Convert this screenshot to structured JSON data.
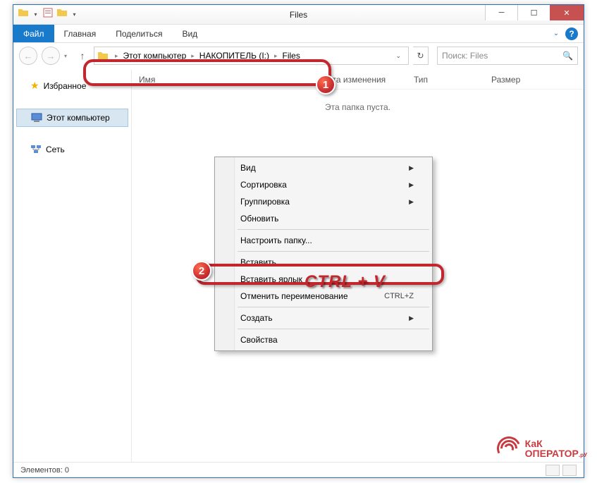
{
  "window": {
    "title": "Files"
  },
  "ribbon": {
    "file": "Файл",
    "tabs": {
      "home": "Главная",
      "share": "Поделиться",
      "view": "Вид"
    }
  },
  "nav": {
    "breadcrumbs": {
      "root_sep": "▸",
      "pc": "Этот компьютер",
      "drive": "НАКОПИТЕЛЬ (I:)",
      "folder": "Files"
    },
    "search_placeholder": "Поиск: Files"
  },
  "sidebar": {
    "favorites": "Избранное",
    "this_pc": "Этот компьютер",
    "network": "Сеть"
  },
  "columns": {
    "name": "Имя",
    "date": "Дата изменения",
    "type": "Тип",
    "size": "Размер"
  },
  "content": {
    "empty": "Эта папка пуста."
  },
  "context_menu": {
    "view": "Вид",
    "sort": "Сортировка",
    "group": "Группировка",
    "refresh": "Обновить",
    "customize": "Настроить папку...",
    "paste": "Вставить",
    "paste_shortcut": "Вставить ярлык",
    "undo_rename": "Отменить переименование",
    "undo_shortcut": "CTRL+Z",
    "new": "Создать",
    "properties": "Свойства"
  },
  "status": {
    "items": "Элементов: 0"
  },
  "annotations": {
    "badge1": "1",
    "badge2": "2",
    "paste_hotkey": "CTRL + V"
  },
  "watermark": {
    "line1": "КаК",
    "line2": "ОПЕРАТОР",
    "suffix": ".рУ"
  }
}
